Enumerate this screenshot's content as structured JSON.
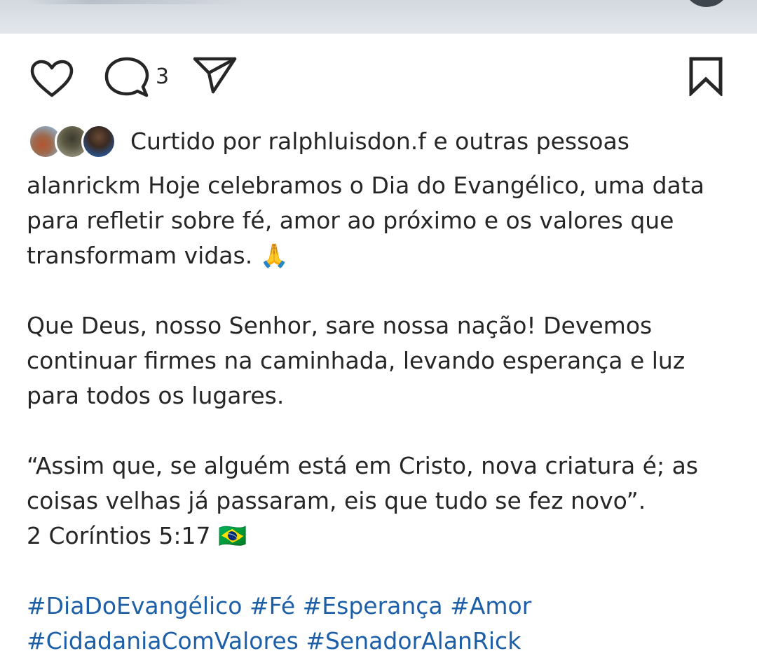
{
  "post": {
    "comment_count": "3",
    "liked_by_text": "Curtido por ralphluisdon.f e outras pessoas",
    "caption": {
      "username": "alanrickm",
      "paragraph1": "Hoje celebramos o Dia do Evangélico, uma data para refletir sobre fé, amor ao próximo e os valores que transformam vidas.",
      "paragraph1_emoji": "🙏",
      "paragraph2": "Que Deus, nosso Senhor, sare nossa nação! Devemos continuar firmes na caminhada, levando esperança e luz para todos os lugares.",
      "quote_line1": "“Assim que, se alguém está em Cristo, nova criatura é; as coisas velhas já passaram, eis que tudo se fez novo”.",
      "quote_reference": "2 Coríntios 5:17",
      "quote_emoji": "🇧🇷",
      "hashtags": [
        "#DiaDoEvangélico",
        "#Fé",
        "#Esperança",
        "#Amor",
        "#CidadaniaComValores",
        "#SenadorAlanRick"
      ]
    }
  },
  "icons": {
    "like": "heart-icon",
    "comment": "comment-bubble-icon",
    "share": "paper-plane-icon",
    "save": "bookmark-icon"
  },
  "colors": {
    "text": "#262626",
    "hashtag": "#1c5fa8",
    "background": "#ffffff"
  }
}
